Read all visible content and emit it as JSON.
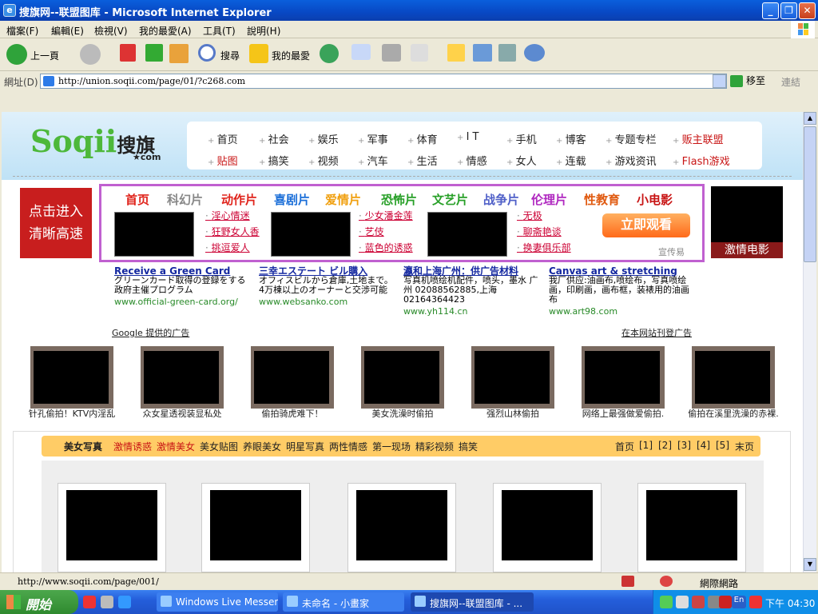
{
  "window": {
    "title": "搜旗网--联盟图库 - Microsoft Internet Explorer"
  },
  "menu": [
    "檔案(F)",
    "編輯(E)",
    "檢視(V)",
    "我的最愛(A)",
    "工具(T)",
    "說明(H)"
  ],
  "toolbar": {
    "back": "上一頁",
    "search": "搜尋",
    "favorites": "我的最愛"
  },
  "address": {
    "label": "網址(D)",
    "url": "http://union.soqii.com/page/01/?c268.com",
    "go": "移至",
    "links": "連結"
  },
  "site": {
    "logo": "Soqii",
    "logo_cn": "搜旗",
    "logo_dom": "★com",
    "nav_row1": [
      "首页",
      "社会",
      "娱乐",
      "军事",
      "体育",
      "I T",
      "手机",
      "博客",
      "专题专栏",
      "贩主联盟"
    ],
    "nav_row2": [
      "贴图",
      "搞笑",
      "视频",
      "汽车",
      "生活",
      "情感",
      "女人",
      "连载",
      "游戏资讯",
      "Flash游戏"
    ],
    "ad_left": [
      "点击进入",
      "清晰高速"
    ],
    "ad_cats": [
      {
        "t": "首页",
        "c": "#e0241c"
      },
      {
        "t": "科幻片",
        "c": "#888"
      },
      {
        "t": "动作片",
        "c": "#e0241c"
      },
      {
        "t": "喜剧片",
        "c": "#1a6ed8"
      },
      {
        "t": "爱情片",
        "c": "#f0a010"
      },
      {
        "t": "恐怖片",
        "c": "#28a028"
      },
      {
        "t": "文艺片",
        "c": "#28a028"
      },
      {
        "t": "战争片",
        "c": "#5060c8"
      },
      {
        "t": "伦理片",
        "c": "#b028c0"
      },
      {
        "t": "性教育",
        "c": "#e05a10"
      },
      {
        "t": "小电影",
        "c": "#c81414"
      }
    ],
    "ad_links1": [
      "淫心情迷",
      "狂野女人香",
      "挑逗爱人"
    ],
    "ad_links2": [
      "少女潘金莲",
      "艺伎",
      "蓝色的诱惑"
    ],
    "ad_links3": [
      "无极",
      "聊斋艳谈",
      "换妻俱乐部"
    ],
    "watch": "立即观看",
    "propaganda": "宣传易",
    "ad_right": "激情电影",
    "google_ads": [
      {
        "h": "Receive a Green Card",
        "b": "グリーンカード取得の登録をする 政府主催プログラム",
        "u": "www.official-green-card.org/"
      },
      {
        "h": "三幸エステート ビル購入",
        "b": "オフィスビルから倉庫,土地まで。 4万棟以上のオーナーと交渉可能",
        "u": "www.websanko.com"
      },
      {
        "h": "瀛和上海广州：供广告材料",
        "b": "写真机喷绘机配件，喷头，墨水 广州 02088562885,上海 02164364423",
        "u": "www.yh114.cn"
      },
      {
        "h": "Canvas art & stretching",
        "b": "我厂供应:油画布,喷绘布，写真喷绘画，印刷画，画布框，装裱用的油画布",
        "u": "www.art98.com"
      }
    ],
    "google_by": "Google 提供的广告",
    "advertise": "在本网站刊登广告",
    "thumbs": [
      "针孔偷拍！KTV内淫乱",
      "众女星透视装显私处",
      "偷拍骑虎难下！",
      "美女洗澡时偷拍",
      "强烈山林偷拍",
      "网络上最强做爱偷拍.",
      "偷拍在溪里洗澡的赤裸."
    ],
    "catbar": [
      {
        "t": "美女写真",
        "s": "b"
      },
      {
        "t": "激情诱惑",
        "s": "r"
      },
      {
        "t": "激情美女",
        "s": "r"
      },
      {
        "t": "美女贴图",
        "s": ""
      },
      {
        "t": "养眼美女",
        "s": ""
      },
      {
        "t": "明星写真",
        "s": ""
      },
      {
        "t": "两性情感",
        "s": ""
      },
      {
        "t": "第一现场",
        "s": ""
      },
      {
        "t": "精彩视频",
        "s": ""
      },
      {
        "t": "搞笑",
        "s": ""
      }
    ],
    "paging": [
      "首页",
      "[1]",
      "[2]",
      "[3]",
      "[4]",
      "[5]",
      "末页"
    ]
  },
  "status": {
    "text": "http://www.soqii.com/page/001/",
    "zone": "網際網路"
  },
  "taskbar": {
    "start": "開始",
    "buttons": [
      "Windows Live Messen...",
      "未命名 - 小畫家",
      "搜旗网--联盟图库 - ..."
    ],
    "clock": "下午 04:30",
    "lang": "En"
  }
}
